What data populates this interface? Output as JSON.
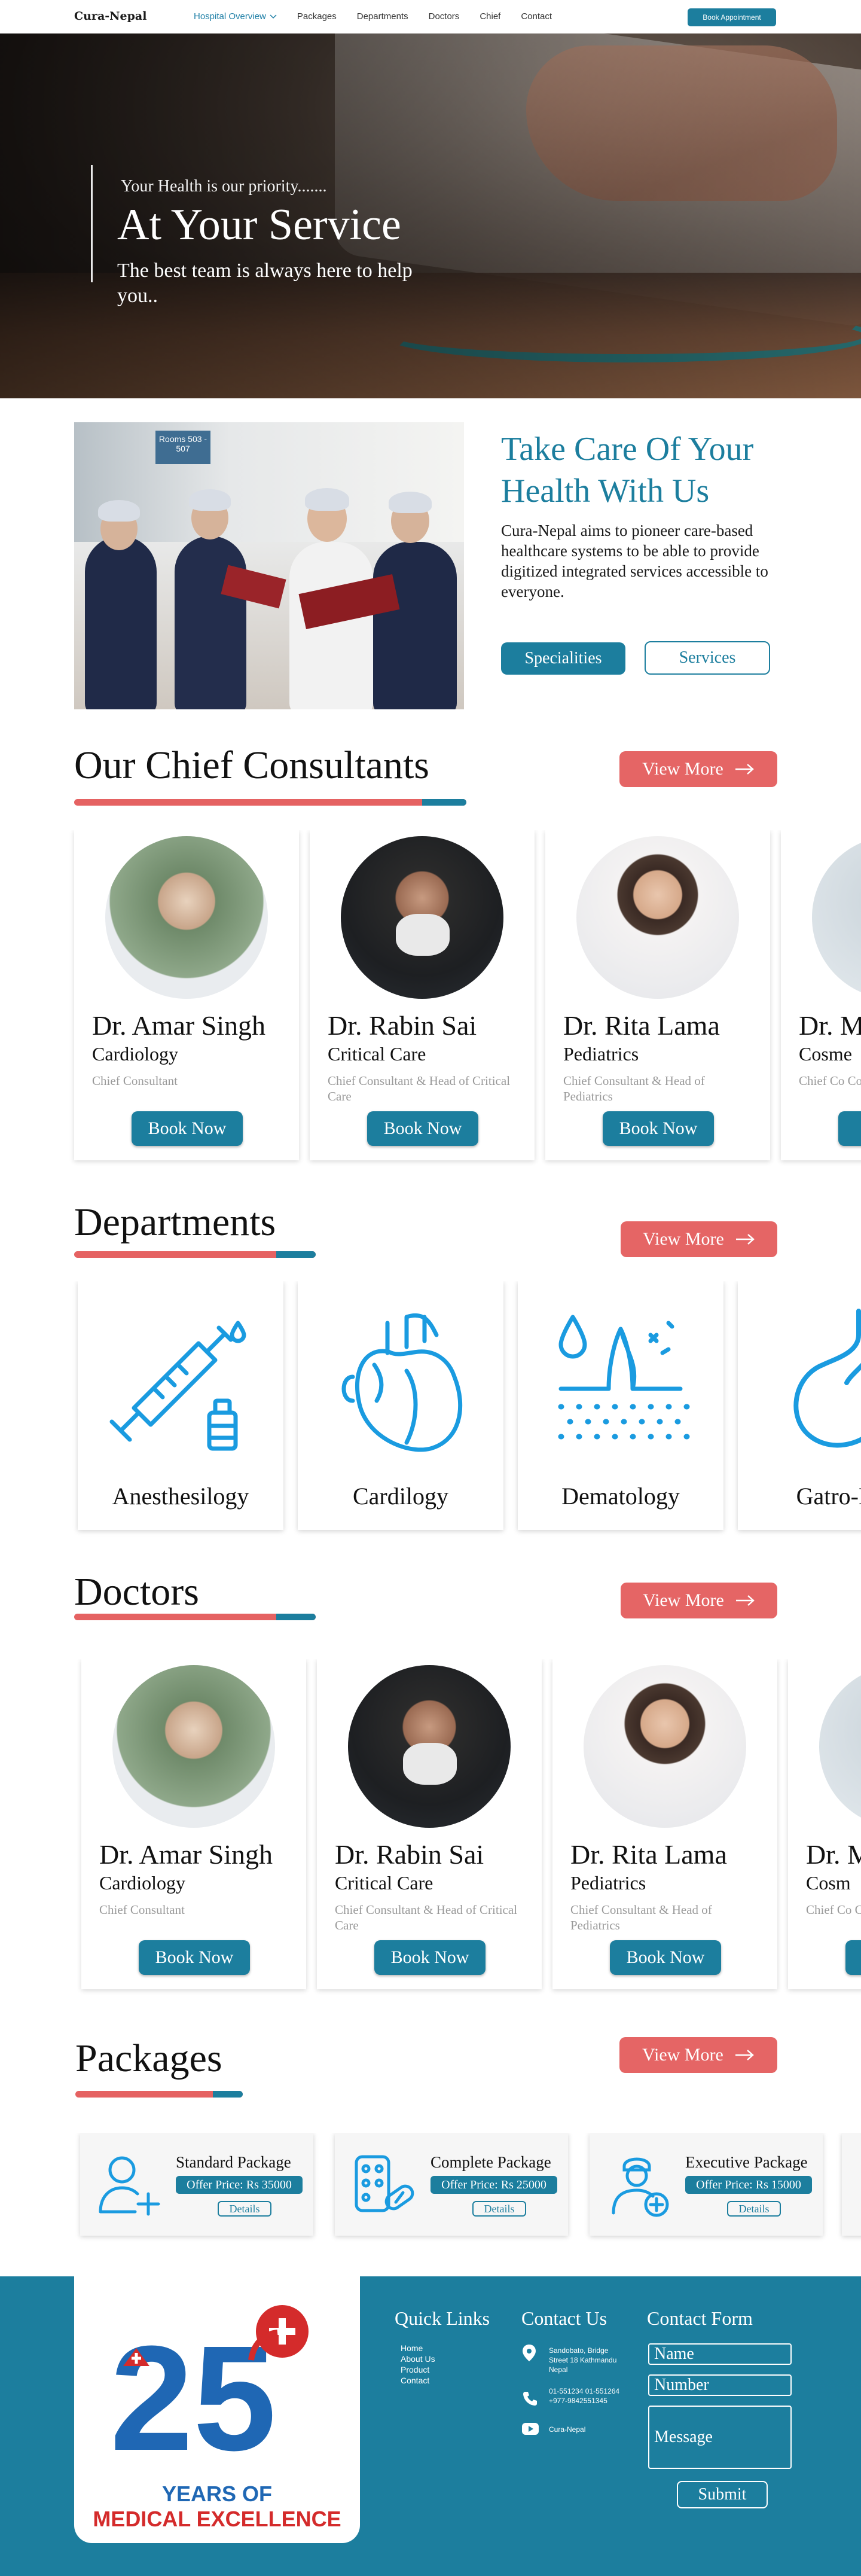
{
  "nav": {
    "brand": "Cura-Nepal",
    "links": [
      "Hospital Overview",
      "Packages",
      "Departments",
      "Doctors",
      "Chief",
      "Contact"
    ],
    "book_label": "Book Appointment"
  },
  "hero": {
    "pre": "Your Health is our priority.......",
    "title": "At Your Service",
    "subtitle": "The best team is always here to help you.."
  },
  "about": {
    "sign": "Rooms 503 - 507",
    "title": "Take Care Of Your Health With Us",
    "text": "Cura-Nepal aims to pioneer care-based healthcare systems to be able to provide digitized integrated services accessible to everyone.",
    "btn_specialities": "Specialities",
    "btn_services": "Services"
  },
  "chief": {
    "title": "Our Chief Consultants",
    "view_more": "View More",
    "cards": [
      {
        "name": "Dr. Amar Singh",
        "specialty": "Cardiology",
        "role": "Chief Consultant",
        "book": "Book Now"
      },
      {
        "name": "Dr. Rabin Sai",
        "specialty": "Critical Care",
        "role": "Chief Consultant & Head of Critical Care",
        "book": "Book Now"
      },
      {
        "name": "Dr. Rita Lama",
        "specialty": "Pediatrics",
        "role": "Chief Consultant & Head of Pediatrics",
        "book": "Book Now"
      },
      {
        "name": "Dr. M",
        "specialty": "Cosme",
        "role": "Chief Co Cosmetic",
        "book": "B"
      }
    ]
  },
  "departments": {
    "title": "Departments",
    "view_more": "View More",
    "items": [
      "Anesthesilogy",
      "Cardilogy",
      "Dematology",
      "Gatro-En"
    ]
  },
  "doctors": {
    "title": "Doctors",
    "view_more": "View More",
    "cards": [
      {
        "name": "Dr. Amar Singh",
        "specialty": "Cardiology",
        "role": "Chief Consultant",
        "book": "Book Now"
      },
      {
        "name": "Dr. Rabin Sai",
        "specialty": "Critical Care",
        "role": "Chief Consultant & Head of Critical Care",
        "book": "Book Now"
      },
      {
        "name": "Dr. Rita Lama",
        "specialty": "Pediatrics",
        "role": "Chief Consultant & Head of Pediatrics",
        "book": "Book Now"
      },
      {
        "name": "Dr. M",
        "specialty": "Cosm",
        "role": "Chief Co Cosmetic",
        "book": ""
      }
    ]
  },
  "packages": {
    "title": "Packages",
    "view_more": "View More",
    "items": [
      {
        "name": "Standard Package",
        "offer": "Offer Price: Rs 35000",
        "details": "Details"
      },
      {
        "name": "Complete Package",
        "offer": "Offer Price: Rs 25000",
        "details": "Details"
      },
      {
        "name": "Executive Package",
        "offer": "Offer Price: Rs 15000",
        "details": "Details"
      }
    ]
  },
  "footer": {
    "logo_line1": "YEARS OF",
    "logo_line2": "MEDICAL EXCELLENCE",
    "logo_number": "25",
    "quick_links_title": "Quick Links",
    "quick_links": [
      "Home",
      "About Us",
      "Product",
      "Contact"
    ],
    "contact_title": "Contact Us",
    "address": "Sandobato, Bridge Street 18 Kathmandu Nepal",
    "phones": "01-551234 01-551264 +977-9842551345",
    "youtube": "Cura-Nepal",
    "form_title": "Contact Form",
    "form_name": "Name",
    "form_number": "Number",
    "form_message": "Message",
    "submit": "Submit"
  },
  "colors": {
    "accent": "#1c7e9e",
    "red": "#e56565",
    "icon_blue": "#1a9be0"
  }
}
